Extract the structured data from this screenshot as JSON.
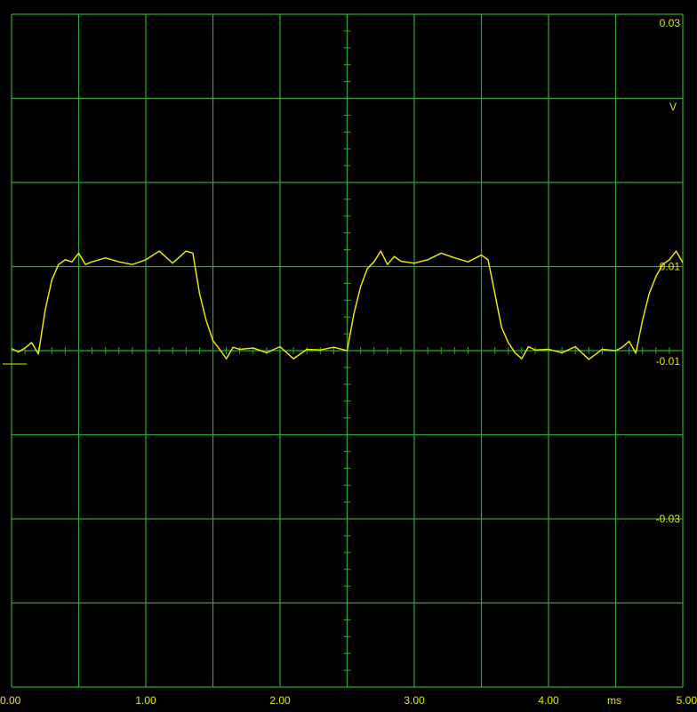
{
  "colors": {
    "background": "#000000",
    "grid": "#2ea82e",
    "trace": "#e8e800",
    "labels": "#e8e800"
  },
  "chart_data": {
    "type": "line",
    "title": "",
    "xlabel": "ms",
    "ylabel": "V",
    "xlim": [
      0,
      5
    ],
    "ylim": [
      -0.03,
      0.03
    ],
    "grid": true,
    "x_ticks": [
      {
        "value": 0,
        "label": "0.00"
      },
      {
        "value": 1,
        "label": "1.00"
      },
      {
        "value": 2,
        "label": "2.00"
      },
      {
        "value": 3,
        "label": "3.00"
      },
      {
        "value": 4,
        "label": "4.00"
      },
      {
        "value": 5,
        "label": "5.00"
      }
    ],
    "y_ticks": [
      {
        "value": 0.03,
        "label": "0.03"
      },
      {
        "value": 0.0125,
        "label": "0.01"
      },
      {
        "value": 0,
        "label": "-0.01"
      },
      {
        "value": -0.0125,
        "label": "-0.03"
      }
    ],
    "series": [
      {
        "x": [
          0,
          0.05,
          0.1,
          0.15,
          0.2,
          0.25,
          0.3,
          0.35,
          0.4,
          0.45,
          0.5,
          0.55,
          0.6,
          0.7,
          0.8,
          0.9,
          1.0,
          1.1,
          1.2,
          1.3,
          1.35,
          1.4,
          1.45,
          1.5,
          1.55,
          1.6,
          1.65,
          1.7,
          1.8,
          1.9,
          2.0,
          2.1,
          2.2,
          2.3,
          2.4,
          2.5,
          2.55,
          2.6,
          2.65,
          2.7,
          2.75,
          2.8,
          2.85,
          2.9,
          3.0,
          3.1,
          3.2,
          3.3,
          3.4,
          3.5,
          3.55,
          3.6,
          3.65,
          3.7,
          3.75,
          3.8,
          3.85,
          3.9,
          4.0,
          4.1,
          4.2,
          4.3,
          4.4,
          4.5,
          4.55,
          4.6,
          4.65,
          4.7,
          4.75,
          4.8,
          4.85,
          4.9,
          4.95,
          5.0
        ],
        "y": [
          0.0003,
          -0.0002,
          0.0004,
          0.0012,
          -0.0005,
          0.006,
          0.0105,
          0.0128,
          0.0135,
          0.0132,
          0.0145,
          0.0128,
          0.0132,
          0.0138,
          0.0132,
          0.0128,
          0.0135,
          0.0148,
          0.013,
          0.0148,
          0.0145,
          0.0085,
          0.0045,
          0.0015,
          0.0002,
          -0.0012,
          0.0005,
          0.0002,
          0.0004,
          -0.0003,
          0.0006,
          -0.0012,
          0.0002,
          0.0001,
          0.0005,
          0.0,
          0.0055,
          0.0095,
          0.0122,
          0.0132,
          0.0148,
          0.0128,
          0.014,
          0.0133,
          0.013,
          0.0135,
          0.0145,
          0.0138,
          0.0132,
          0.0142,
          0.0135,
          0.0085,
          0.0035,
          0.0012,
          -0.0003,
          -0.0012,
          0.0006,
          0.0001,
          0.0002,
          -0.0003,
          0.0006,
          -0.0013,
          0.0002,
          0.0,
          0.0005,
          0.0014,
          -0.0004,
          0.0045,
          0.0085,
          0.011,
          0.0128,
          0.0135,
          0.0148,
          0.0131
        ]
      }
    ]
  }
}
